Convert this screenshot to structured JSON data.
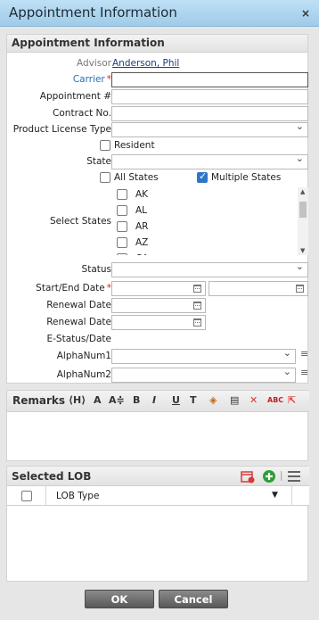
{
  "window": {
    "title": "Appointment Information",
    "close_symbol": "×"
  },
  "form": {
    "section_title": "Appointment Information",
    "advisor_label": "Advisor",
    "advisor_value": "Anderson, Phil",
    "carrier_label": "Carrier",
    "required_mark": "*",
    "carrier_value": "",
    "appointment_no_label": "Appointment #",
    "appointment_no_value": "",
    "contract_no_label": "Contract No.",
    "contract_no_value": "",
    "product_license_type_label": "Product License Type",
    "product_license_type_value": "",
    "resident_label": "Resident",
    "resident_checked": false,
    "state_label": "State",
    "state_value": "",
    "all_states_label": "All States",
    "all_states_checked": false,
    "multiple_states_label": "Multiple States",
    "multiple_states_checked": true,
    "select_states_label": "Select States",
    "states": [
      {
        "code": "AK",
        "checked": false
      },
      {
        "code": "AL",
        "checked": false
      },
      {
        "code": "AR",
        "checked": false
      },
      {
        "code": "AZ",
        "checked": false
      },
      {
        "code": "CA",
        "checked": false
      }
    ],
    "status_label": "Status",
    "status_value": "",
    "start_end_date_label": "Start/End Date",
    "start_date_value": "",
    "end_date_value": "",
    "renewal_date_label": "Renewal Date",
    "renewal_date_value": "",
    "renewal_date2_label": "Renewal Date",
    "renewal_date2_value": "",
    "estatus_date_label": "E-Status/Date",
    "alphanum1_label": "AlphaNum1",
    "alphanum1_value": "",
    "alphanum2_label": "AlphaNum2",
    "alphanum2_value": ""
  },
  "remarks": {
    "label": "Remarks",
    "toolbar": [
      "⟨H⟩",
      "A",
      "A≑",
      "B",
      "I",
      "U",
      "T",
      "◈",
      "▤",
      "✕",
      "ABC",
      "⇱"
    ],
    "text": ""
  },
  "lob": {
    "title": "Selected LOB",
    "column_lob_type": "LOB Type",
    "sort_arrow": "▼",
    "rows": []
  },
  "buttons": {
    "ok_label": "OK",
    "cancel_label": "Cancel"
  },
  "colors": {
    "accent_blue": "#2f76c8",
    "required_red": "#d02020",
    "green_add": "#2e9e3a",
    "red_icon": "#d83a3a"
  }
}
